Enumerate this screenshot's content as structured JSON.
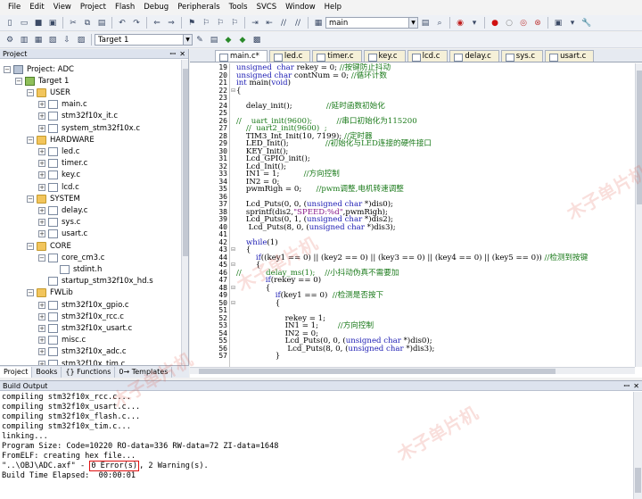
{
  "menu": [
    "File",
    "Edit",
    "View",
    "Project",
    "Flash",
    "Debug",
    "Peripherals",
    "Tools",
    "SVCS",
    "Window",
    "Help"
  ],
  "toolbar1": {
    "find_combo_value": "main"
  },
  "toolbar2": {
    "target_combo_value": "Target 1"
  },
  "project_panel": {
    "title": "Project",
    "tree": [
      {
        "label": "Project: ADC",
        "level": 0,
        "kind": "root",
        "expander": "-"
      },
      {
        "label": "Target 1",
        "level": 1,
        "kind": "target",
        "expander": "-"
      },
      {
        "label": "USER",
        "level": 2,
        "kind": "folder",
        "expander": "-"
      },
      {
        "label": "main.c",
        "level": 3,
        "kind": "file",
        "expander": "+"
      },
      {
        "label": "stm32f10x_it.c",
        "level": 3,
        "kind": "file",
        "expander": "+"
      },
      {
        "label": "system_stm32f10x.c",
        "level": 3,
        "kind": "file",
        "expander": "+"
      },
      {
        "label": "HARDWARE",
        "level": 2,
        "kind": "folder",
        "expander": "-"
      },
      {
        "label": "led.c",
        "level": 3,
        "kind": "file",
        "expander": "+"
      },
      {
        "label": "timer.c",
        "level": 3,
        "kind": "file",
        "expander": "+"
      },
      {
        "label": "key.c",
        "level": 3,
        "kind": "file",
        "expander": "+"
      },
      {
        "label": "lcd.c",
        "level": 3,
        "kind": "file",
        "expander": "+"
      },
      {
        "label": "SYSTEM",
        "level": 2,
        "kind": "folder",
        "expander": "-"
      },
      {
        "label": "delay.c",
        "level": 3,
        "kind": "file",
        "expander": "+"
      },
      {
        "label": "sys.c",
        "level": 3,
        "kind": "file",
        "expander": "+"
      },
      {
        "label": "usart.c",
        "level": 3,
        "kind": "file",
        "expander": "+"
      },
      {
        "label": "CORE",
        "level": 2,
        "kind": "folder",
        "expander": "-"
      },
      {
        "label": "core_cm3.c",
        "level": 3,
        "kind": "file",
        "expander": "-"
      },
      {
        "label": "stdint.h",
        "level": 4,
        "kind": "file",
        "expander": ""
      },
      {
        "label": "startup_stm32f10x_hd.s",
        "level": 3,
        "kind": "file",
        "expander": ""
      },
      {
        "label": "FWLib",
        "level": 2,
        "kind": "folder",
        "expander": "-"
      },
      {
        "label": "stm32f10x_gpio.c",
        "level": 3,
        "kind": "file",
        "expander": "+"
      },
      {
        "label": "stm32f10x_rcc.c",
        "level": 3,
        "kind": "file",
        "expander": "+"
      },
      {
        "label": "stm32f10x_usart.c",
        "level": 3,
        "kind": "file",
        "expander": "+"
      },
      {
        "label": "misc.c",
        "level": 3,
        "kind": "file",
        "expander": "+"
      },
      {
        "label": "stm32f10x_adc.c",
        "level": 3,
        "kind": "file",
        "expander": "+"
      },
      {
        "label": "stm32f10x_tim.c",
        "level": 3,
        "kind": "file",
        "expander": "+"
      }
    ],
    "tabs": [
      "Project",
      "Books",
      "{} Functions",
      "0→ Templates"
    ]
  },
  "editor": {
    "tabs": [
      "main.c*",
      "led.c",
      "timer.c",
      "key.c",
      "lcd.c",
      "delay.c",
      "sys.c",
      "usart.c"
    ],
    "active_tab": "main.c*",
    "lines": [
      {
        "n": "19",
        "f": "",
        "t": "unsigned  char rekey = 0; //按键防止抖动"
      },
      {
        "n": "20",
        "f": "",
        "t": "unsigned char contNum = 0; //循环计数"
      },
      {
        "n": "21",
        "f": "",
        "t": "int main(void)"
      },
      {
        "n": "22",
        "f": "⊟",
        "t": "{"
      },
      {
        "n": "23",
        "f": "",
        "t": ""
      },
      {
        "n": "24",
        "f": "",
        "t": "    delay_init();              //延时函数初始化"
      },
      {
        "n": "25",
        "f": "",
        "t": ""
      },
      {
        "n": "26",
        "f": "",
        "t": "//    uart_init(9600);          //串口初始化为115200"
      },
      {
        "n": "27",
        "f": "",
        "t": "    //  uart2_init(9600)  ;"
      },
      {
        "n": "28",
        "f": "",
        "t": "    TIM3_Int_Init(10, 7199); //定时器"
      },
      {
        "n": "29",
        "f": "",
        "t": "    LED_Init();               //初始化与LED连接的硬件接口"
      },
      {
        "n": "30",
        "f": "",
        "t": "    KEY_Init();"
      },
      {
        "n": "31",
        "f": "",
        "t": "    Lcd_GPIO_init();"
      },
      {
        "n": "32",
        "f": "",
        "t": "    Lcd_Init();"
      },
      {
        "n": "33",
        "f": "",
        "t": "    IN1 = 1;          //方向控制"
      },
      {
        "n": "34",
        "f": "",
        "t": "    IN2 = 0;"
      },
      {
        "n": "35",
        "f": "",
        "t": "    pwmRigh = 0;      //pwm调整,电机转速调整"
      },
      {
        "n": "36",
        "f": "",
        "t": ""
      },
      {
        "n": "37",
        "f": "",
        "t": "    Lcd_Puts(0, 0, (unsigned char *)dis0);"
      },
      {
        "n": "38",
        "f": "",
        "t": "    sprintf(dis2,\"SPEED:%d\",pwmRigh);"
      },
      {
        "n": "39",
        "f": "",
        "t": "    Lcd_Puts(0, 1, (unsigned char *)dis2);"
      },
      {
        "n": "40",
        "f": "",
        "t": "     Lcd_Puts(8, 0, (unsigned char *)dis3);"
      },
      {
        "n": "41",
        "f": "",
        "t": ""
      },
      {
        "n": "42",
        "f": "",
        "t": "    while(1)"
      },
      {
        "n": "43",
        "f": "⊟",
        "t": "    {"
      },
      {
        "n": "44",
        "f": "",
        "t": "        if((key1 == 0) || (key2 == 0) || (key3 == 0) || (key4 == 0) || (key5 == 0)) //检测到按键"
      },
      {
        "n": "45",
        "f": "⊟",
        "t": "        {"
      },
      {
        "n": "46",
        "f": "",
        "t": "//          delay_ms(1);    //小抖动伪真不需要加"
      },
      {
        "n": "47",
        "f": "",
        "t": "            if(rekey == 0)"
      },
      {
        "n": "48",
        "f": "⊟",
        "t": "            {"
      },
      {
        "n": "49",
        "f": "",
        "t": "                if(key1 == 0)  //检测是否按下"
      },
      {
        "n": "50",
        "f": "⊟",
        "t": "                {"
      },
      {
        "n": "51",
        "f": "",
        "t": ""
      },
      {
        "n": "52",
        "f": "",
        "t": "                    rekey = 1;"
      },
      {
        "n": "53",
        "f": "",
        "t": "                    IN1 = 1;        //方向控制"
      },
      {
        "n": "54",
        "f": "",
        "t": "                    IN2 = 0;"
      },
      {
        "n": "55",
        "f": "",
        "t": "                    Lcd_Puts(0, 0, (unsigned char *)dis0);"
      },
      {
        "n": "56",
        "f": "",
        "t": "                     Lcd_Puts(8, 0, (unsigned char *)dis3);"
      },
      {
        "n": "57",
        "f": "",
        "t": "                }"
      }
    ]
  },
  "build_output": {
    "title": "Build Output",
    "lines": [
      "compiling stm32f10x_rcc.c...",
      "compiling stm32f10x_usart.c...",
      "compiling stm32f10x_flash.c...",
      "compiling stm32f10x_tim.c...",
      "linking...",
      "Program Size: Code=10220 RO-data=336 RW-data=72 ZI-data=1648",
      "FromELF: creating hex file..."
    ],
    "result_prefix": "\"..\\OBJ\\ADC.axf\" - ",
    "result_errors": "0 Error(s)",
    "result_suffix": ", 2 Warning(s).",
    "elapsed": "Build Time Elapsed:  00:00:01"
  },
  "watermark_text": "木子单片机"
}
